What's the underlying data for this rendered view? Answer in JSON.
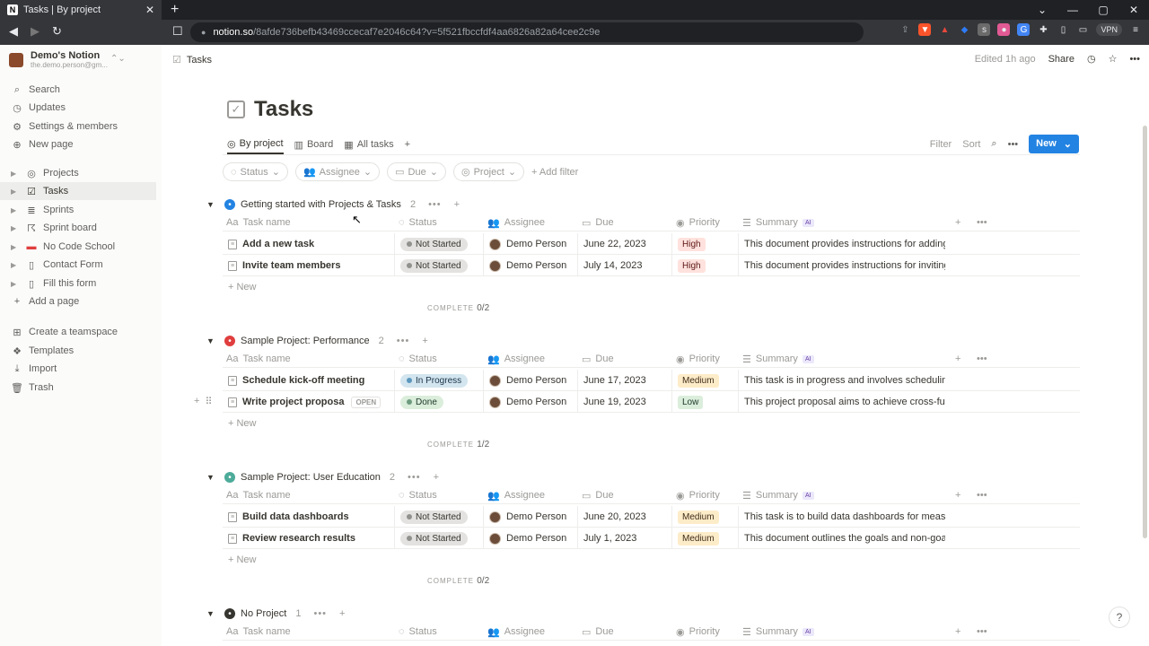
{
  "browser": {
    "tab_title": "Tasks | By project",
    "url_host": "notion.so",
    "url_path": "/8afde736befb43469ccecaf7e2046c64?v=5f521fbccfdf4aa6826a82a64cee2c9e",
    "vpn_label": "VPN"
  },
  "sidebar": {
    "workspace_name": "Demo's Notion",
    "workspace_email": "the.demo.person@gm...",
    "top_items": [
      {
        "label": "Search",
        "icon": "search-icon"
      },
      {
        "label": "Updates",
        "icon": "clock-icon"
      },
      {
        "label": "Settings & members",
        "icon": "gear-icon"
      },
      {
        "label": "New page",
        "icon": "plus-circle-icon"
      }
    ],
    "pages": [
      {
        "label": "Projects",
        "icon": "target-icon"
      },
      {
        "label": "Tasks",
        "icon": "checkbox-icon"
      },
      {
        "label": "Sprints",
        "icon": "stack-icon"
      },
      {
        "label": "Sprint board",
        "icon": "runner-icon"
      },
      {
        "label": "No Code School",
        "icon": "book-icon"
      },
      {
        "label": "Contact Form",
        "icon": "page-icon"
      },
      {
        "label": "Fill this form",
        "icon": "page-icon"
      }
    ],
    "add_page": "Add a page",
    "bottom_items": [
      {
        "label": "Create a teamspace",
        "icon": "team-icon"
      },
      {
        "label": "Templates",
        "icon": "templates-icon"
      },
      {
        "label": "Import",
        "icon": "download-icon"
      },
      {
        "label": "Trash",
        "icon": "trash-icon"
      }
    ]
  },
  "topbar": {
    "breadcrumb": "Tasks",
    "edited": "Edited 1h ago",
    "share": "Share"
  },
  "page": {
    "title": "Tasks",
    "views": [
      "By project",
      "Board",
      "All tasks"
    ],
    "filter": "Filter",
    "sort": "Sort",
    "new_button": "New",
    "filter_chips": [
      "Status",
      "Assignee",
      "Due",
      "Project"
    ],
    "add_filter": "Add filter"
  },
  "columns": {
    "task": "Task name",
    "status": "Status",
    "assignee": "Assignee",
    "due": "Due",
    "priority": "Priority",
    "summary": "Summary",
    "ai": "AI"
  },
  "new_label": "New",
  "complete_label": "COMPLETE",
  "open_label": "OPEN",
  "groups": [
    {
      "name": "Getting started with Projects & Tasks",
      "count": "2",
      "complete": "0/2",
      "icon_color": "#2383e2",
      "rows": [
        {
          "task": "Add a new task",
          "status": "Not Started",
          "assignee": "Demo Person",
          "due": "June 22, 2023",
          "priority": "High",
          "summary": "This document provides instructions for adding a"
        },
        {
          "task": "Invite team members",
          "status": "Not Started",
          "assignee": "Demo Person",
          "due": "July 14, 2023",
          "priority": "High",
          "summary": "This document provides instructions for inviting t"
        }
      ]
    },
    {
      "name": "Sample Project: Performance",
      "count": "2",
      "complete": "1/2",
      "icon_color": "#e03e3e",
      "rows": [
        {
          "task": "Schedule kick-off meeting",
          "status": "In Progress",
          "assignee": "Demo Person",
          "due": "June 17, 2023",
          "priority": "Medium",
          "summary": "This task is in progress and involves scheduling a"
        },
        {
          "task": "Write project proposa",
          "status": "Done",
          "assignee": "Demo Person",
          "due": "June 19, 2023",
          "priority": "Low",
          "summary": "This project proposal aims to achieve cross-functi"
        }
      ]
    },
    {
      "name": "Sample Project: User Education",
      "count": "2",
      "complete": "0/2",
      "icon_color": "#4dab9a",
      "rows": [
        {
          "task": "Build data dashboards",
          "status": "Not Started",
          "assignee": "Demo Person",
          "due": "June 20, 2023",
          "priority": "Medium",
          "summary": "This task is to build data dashboards for measurir"
        },
        {
          "task": "Review research results",
          "status": "Not Started",
          "assignee": "Demo Person",
          "due": "July 1, 2023",
          "priority": "Medium",
          "summary": "This document outlines the goals and non-goals"
        }
      ]
    },
    {
      "name": "No Project",
      "count": "1",
      "complete": "",
      "icon_color": "#37352f",
      "rows": []
    }
  ],
  "help": "?"
}
